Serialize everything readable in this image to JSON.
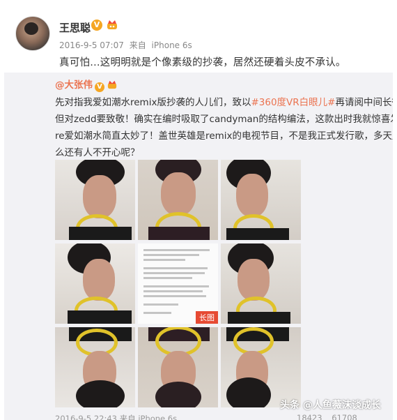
{
  "post": {
    "username": "王思聪",
    "verified_label": "V",
    "timestamp": "2016-9-5 07:07",
    "source_prefix": "来自",
    "source_device": "iPhone 6s",
    "text": "真可怕…这明明就是个像素级的抄袭，居然还硬着头皮不承认。"
  },
  "repost": {
    "author": "@大张伟",
    "verified_label": "V",
    "lines": [
      {
        "before": "先对指我爱如潮水remix版抄袭的人儿们，致以",
        "hashtag": "#360度VR白眼儿#",
        "after": "再请阅中间长微博的褒"
      },
      {
        "text": "但对zedd要致敬！确实在编时吸取了candyman的结构编法，这款出时我就惊喜发现要是"
      },
      {
        "text": "re爱如潮水简直太妙了！盖世英雄是remix的电视节目，不是我正式发行歌，多天赐良缘啊"
      },
      {
        "text": "么还有人不开心呢？"
      }
    ],
    "long_image_badge": "长图",
    "footer": {
      "timestamp": "2016-9-5 22:43",
      "source_prefix": "来自",
      "source_device": "iPhone 6s",
      "reposts": "18423",
      "comments": "61708"
    }
  },
  "watermark": "头条 @人鱼薇沫谈成长",
  "colors": {
    "link_orange": "#eb7350",
    "verified_gold": "#f5a623",
    "repost_bg": "#f2f2f5",
    "long_badge_red": "#e64a33"
  },
  "icons": [
    "vip-crown-icon",
    "verified-badge-icon"
  ]
}
